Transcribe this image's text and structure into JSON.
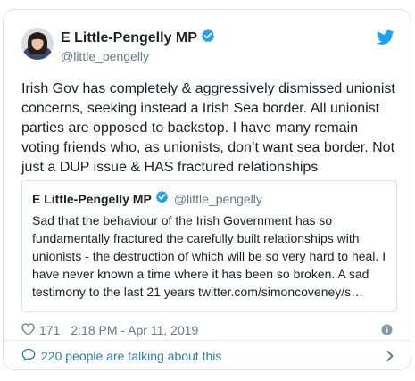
{
  "author": {
    "display_name": "E Little-Pengelly MP",
    "handle": "@little_pengelly",
    "verified": true
  },
  "tweet": {
    "text": "Irish Gov has completely & aggressively dismissed unionist concerns, seeking instead a Irish Sea border. All unionist parties are opposed to backstop. I have many remain voting friends who, as unionists, don’t want sea border. Not just a DUP issue & HAS fractured relationships"
  },
  "quoted_tweet": {
    "display_name": "E Little-Pengelly MP",
    "handle": "@little_pengelly",
    "text": "Sad that the behaviour of the Irish Government has so fundamentally fractured the carefully built relationships with unionists - the destruction of which will be so very hard to heal. I have never known a time where it has been so broken. A sad testimony to the last 21 years twitter.com/simoncoveney/s…"
  },
  "meta": {
    "likes": "171",
    "timestamp": "2:18 PM - Apr 11, 2019"
  },
  "footer": {
    "talking_label": "220 people are talking about this"
  },
  "icons": {
    "brand": "twitter-bird-icon",
    "verified": "verified-badge-icon",
    "like": "heart-icon",
    "info": "info-icon",
    "reply": "speech-bubble-icon",
    "chevron": "chevron-right-icon"
  },
  "colors": {
    "brand_blue": "#1da1f2",
    "link_blue": "#2b7bb9",
    "muted_text": "#697882",
    "border": "#dde3e8"
  }
}
